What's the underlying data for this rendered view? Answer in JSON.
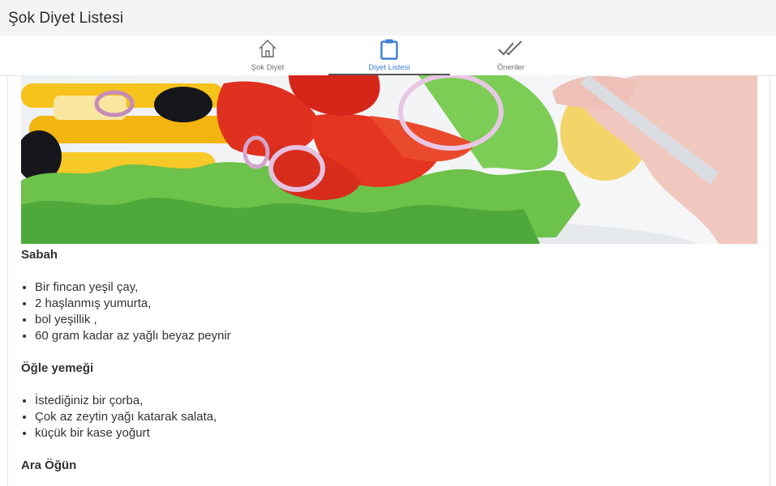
{
  "app": {
    "title": "Şok Diyet Listesi"
  },
  "tabs": [
    {
      "label": "Şok Diyet",
      "icon": "home-icon",
      "active": false
    },
    {
      "label": "Diyet Listesi",
      "icon": "clipboard-icon",
      "active": true
    },
    {
      "label": "Öneriler",
      "icon": "double-check-icon",
      "active": false
    }
  ],
  "colors": {
    "accent": "#3b7fd4",
    "titlebar_bg": "#f4f4f4"
  },
  "sections": [
    {
      "heading": "Sabah",
      "items": [
        "Bir fincan yeşil çay,",
        "2 haşlanmış yumurta,",
        "bol yeşillik ,",
        "60 gram kadar az yağlı beyaz peynir"
      ]
    },
    {
      "heading": "Öğle yemeği",
      "items": [
        "İstediğiniz bir çorba,",
        "Çok az zeytin yağı katarak salata,",
        "küçük bir kase yoğurt"
      ]
    },
    {
      "heading": "Ara Öğün",
      "items": []
    }
  ]
}
